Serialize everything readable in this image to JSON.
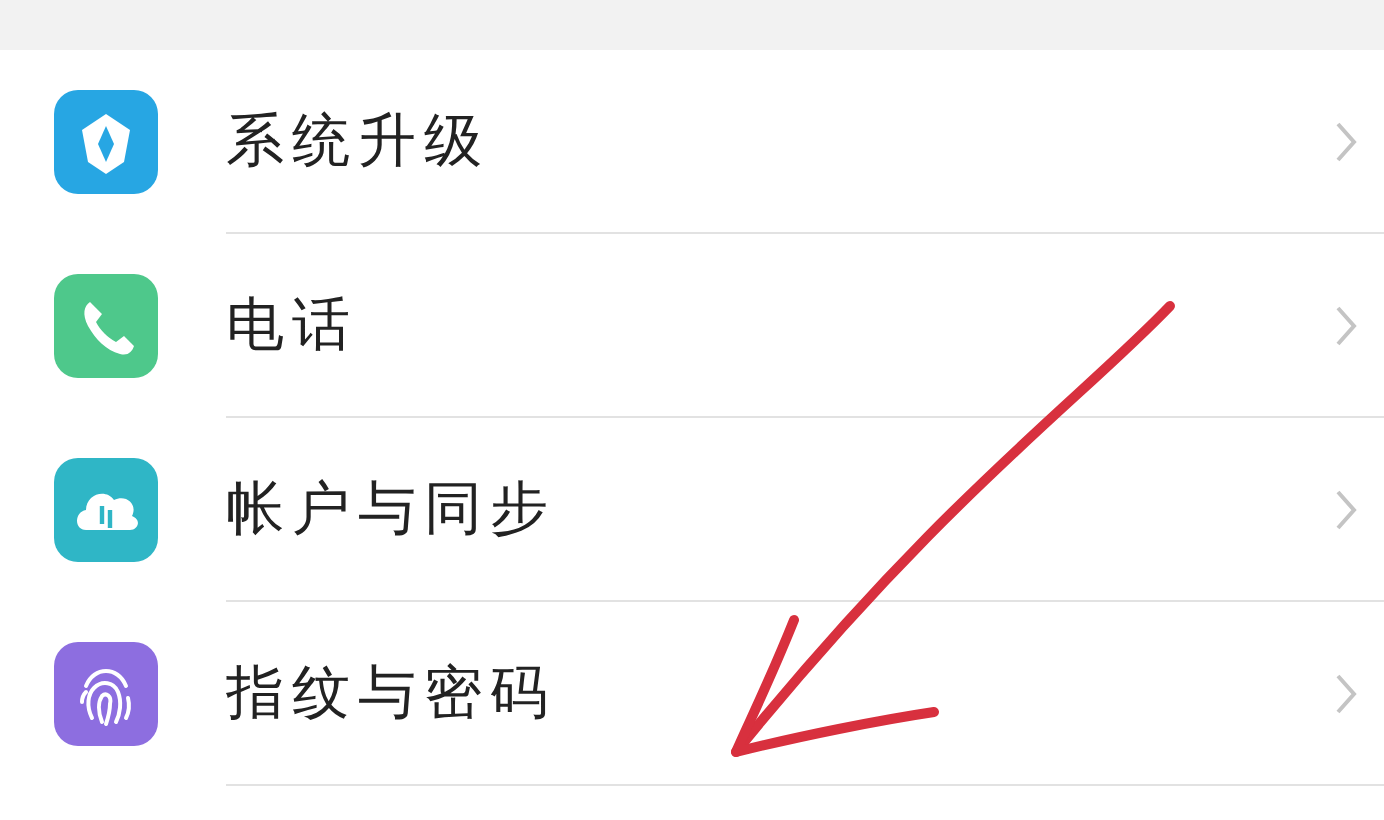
{
  "settings": [
    {
      "label": "系统升级",
      "kind": "update"
    },
    {
      "label": "电话",
      "kind": "phone"
    },
    {
      "label": "帐户与同步",
      "kind": "sync"
    },
    {
      "label": "指纹与密码",
      "kind": "fingerprint"
    }
  ]
}
